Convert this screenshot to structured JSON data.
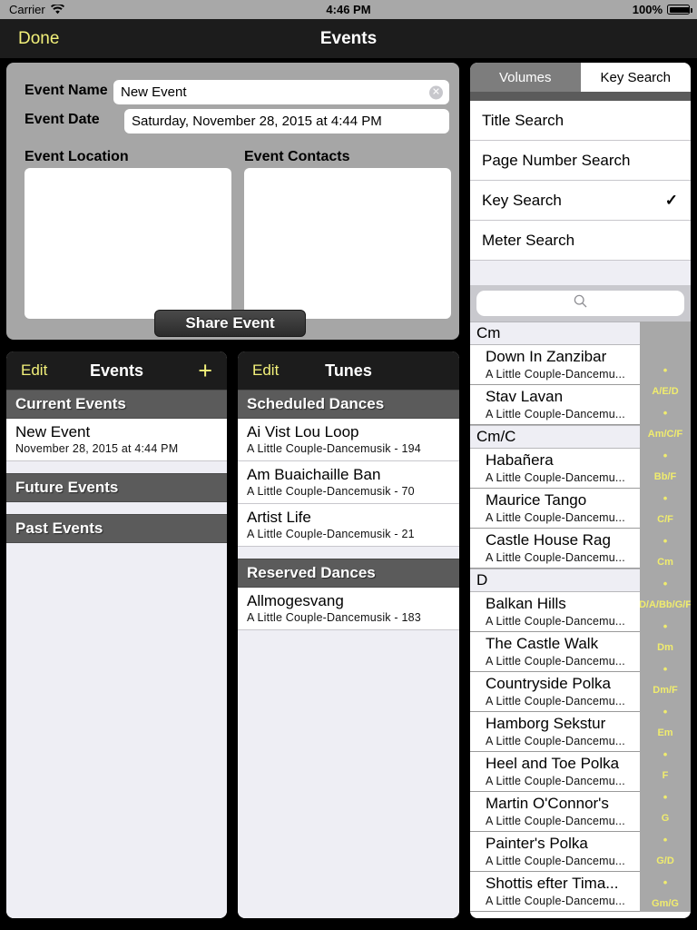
{
  "status_bar": {
    "carrier": "Carrier",
    "wifi_icon": "wifi-icon",
    "time": "4:46 PM",
    "battery_pct": "100%",
    "battery_icon": "battery-icon"
  },
  "navbar": {
    "done_label": "Done",
    "title": "Events"
  },
  "event_form": {
    "name_label": "Event Name",
    "name_value": "New Event",
    "name_placeholder": "Event Name",
    "clear_icon": "clear-icon",
    "date_label": "Event Date",
    "date_value": "Saturday, November 28, 2015 at 4:44 PM",
    "location_label": "Event Location",
    "location_value": "",
    "contacts_label": "Event Contacts",
    "contacts_value": "",
    "share_label": "Share Event"
  },
  "events_panel": {
    "edit_label": "Edit",
    "title": "Events",
    "add_icon": "plus-icon",
    "sections": [
      {
        "header": "Current Events",
        "rows": [
          {
            "title": "New Event",
            "subtitle": "November 28, 2015 at 4:44 PM"
          }
        ]
      },
      {
        "header": "Future Events",
        "rows": []
      },
      {
        "header": "Past Events",
        "rows": []
      }
    ]
  },
  "tunes_panel": {
    "edit_label": "Edit",
    "title": "Tunes",
    "sections": [
      {
        "header": "Scheduled Dances",
        "rows": [
          {
            "title": "Ai Vist Lou Loop",
            "subtitle": "A Little Couple-Dancemusik - 194"
          },
          {
            "title": "Am Buaichaille Ban",
            "subtitle": "A Little Couple-Dancemusik - 70"
          },
          {
            "title": "Artist Life",
            "subtitle": "A Little Couple-Dancemusik - 21"
          }
        ]
      },
      {
        "header": "Reserved Dances",
        "rows": [
          {
            "title": "Allmogesvang",
            "subtitle": "A Little Couple-Dancemusik - 183"
          }
        ]
      }
    ]
  },
  "right_panel": {
    "tabs": [
      {
        "label": "Volumes",
        "active": false
      },
      {
        "label": "Key Search",
        "active": true
      }
    ],
    "search_options": [
      {
        "label": "Title Search",
        "checked": false
      },
      {
        "label": "Page Number Search",
        "checked": false
      },
      {
        "label": "Key Search",
        "checked": true
      },
      {
        "label": "Meter Search",
        "checked": false
      }
    ],
    "check_glyph": "✓",
    "search": {
      "value": "",
      "placeholder": "",
      "icon": "search-icon"
    },
    "results": [
      {
        "header": "Cm",
        "rows": [
          {
            "title": "Down In Zanzibar",
            "subtitle": "A Little Couple-Dancemu..."
          },
          {
            "title": "Stav Lavan",
            "subtitle": "A Little Couple-Dancemu..."
          }
        ]
      },
      {
        "header": "Cm/C",
        "rows": [
          {
            "title": "Habañera",
            "subtitle": "A Little Couple-Dancemu..."
          },
          {
            "title": "Maurice Tango",
            "subtitle": "A Little Couple-Dancemu..."
          },
          {
            "title": "Castle House Rag",
            "subtitle": "A Little Couple-Dancemu..."
          }
        ]
      },
      {
        "header": "D",
        "rows": [
          {
            "title": "Balkan Hills",
            "subtitle": "A Little Couple-Dancemu..."
          },
          {
            "title": "The Castle Walk",
            "subtitle": "A Little Couple-Dancemu..."
          },
          {
            "title": "Countryside Polka",
            "subtitle": "A Little Couple-Dancemu..."
          },
          {
            "title": "Hamborg Sekstur",
            "subtitle": "A Little Couple-Dancemu..."
          },
          {
            "title": "Heel and Toe Polka",
            "subtitle": "A Little Couple-Dancemu..."
          },
          {
            "title": "Martin O'Connor's",
            "subtitle": "A Little Couple-Dancemu..."
          },
          {
            "title": "Painter's Polka",
            "subtitle": "A Little Couple-Dancemu..."
          },
          {
            "title": "Shottis efter Tima...",
            "subtitle": "A Little Couple-Dancemu..."
          }
        ]
      }
    ],
    "index_bar": [
      "•",
      "A/E/D",
      "•",
      "Am/C/F",
      "•",
      "Bb/F",
      "•",
      "C/F",
      "•",
      "Cm",
      "•",
      "D/A/Bb/G/F",
      "•",
      "Dm",
      "•",
      "Dm/F",
      "•",
      "Em",
      "•",
      "F",
      "•",
      "G",
      "•",
      "G/D",
      "•",
      "Gm/G"
    ]
  },
  "colors": {
    "accent_yellow": "#f2f07a",
    "index_yellow": "#f0ec6e",
    "navbar_dark": "#1c1c1c",
    "form_gray": "#a6a6a6",
    "section_gray": "#5b5b5b",
    "list_bg": "#eeeef4",
    "statusbar_gray": "#a8a8a8"
  }
}
